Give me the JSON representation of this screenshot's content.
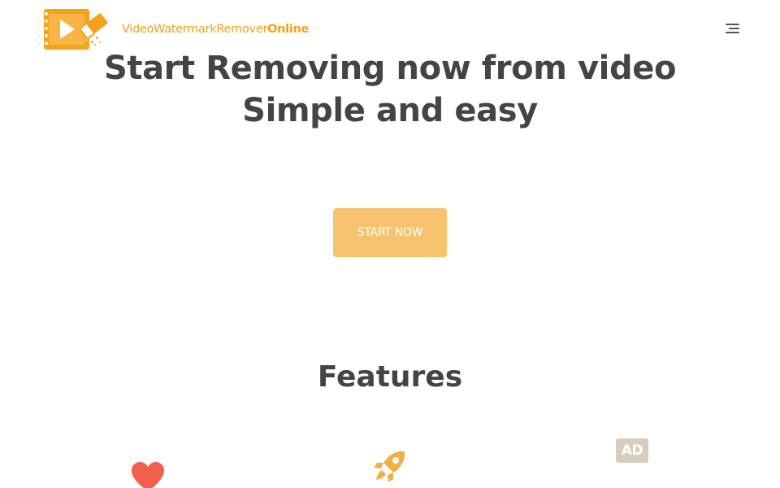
{
  "header": {
    "logo_text_regular": "VideoWatermarkRemover",
    "logo_text_bold": "Online",
    "menu_icon": "hamburger-menu-icon"
  },
  "hero": {
    "title_line1": "Start Removing now from video",
    "title_line2": "Simple and easy",
    "cta_label": "START NOW"
  },
  "features": {
    "title": "Features",
    "items": [
      {
        "icon": "heart-icon",
        "color": "#f0604d"
      },
      {
        "icon": "rocket-icon",
        "color": "#f2b044"
      },
      {
        "icon": "ad-block-icon",
        "label": "AD",
        "color": "#d7cdbd"
      }
    ]
  },
  "colors": {
    "brand": "#f0a020",
    "cta": "#f7c26e",
    "heading": "#444444"
  }
}
